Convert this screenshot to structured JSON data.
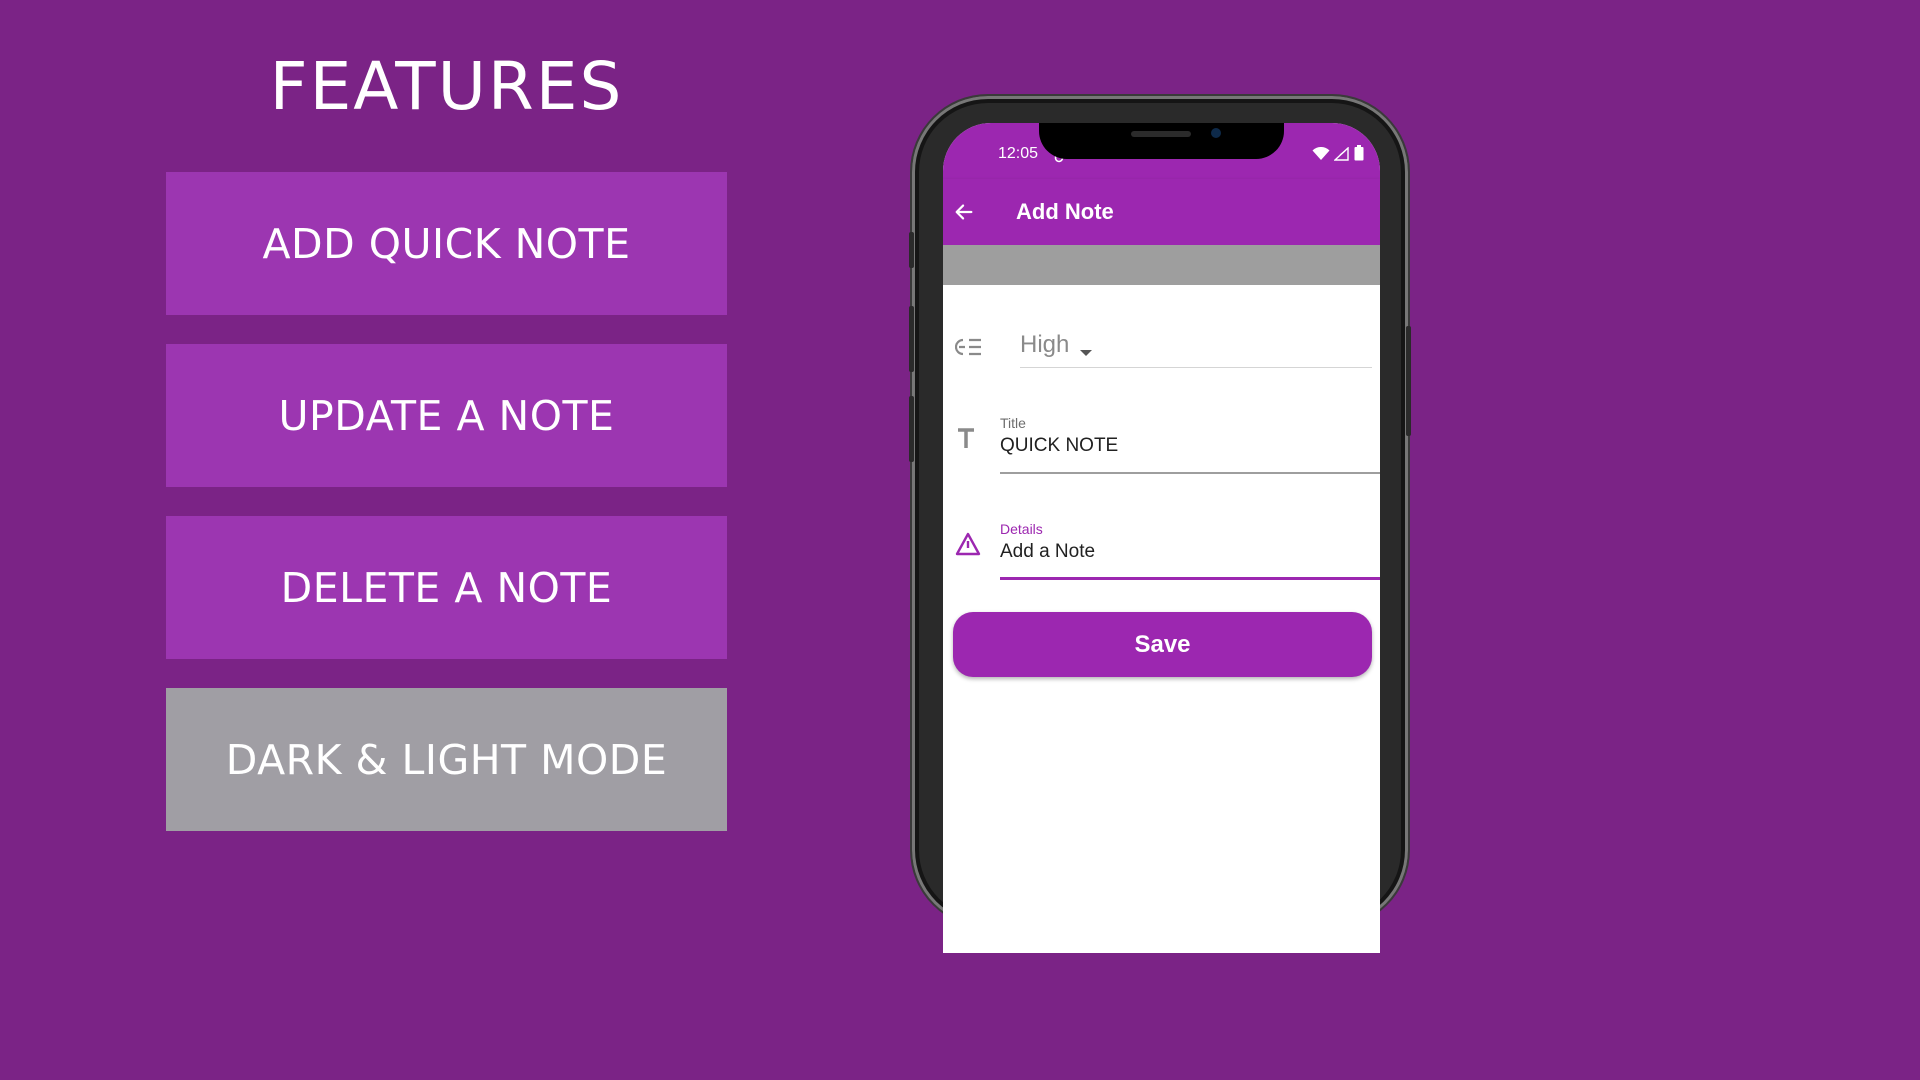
{
  "features": {
    "title": "FEATURES",
    "items": [
      {
        "label": "ADD QUICK NOTE"
      },
      {
        "label": "UPDATE A NOTE"
      },
      {
        "label": "DELETE A NOTE"
      },
      {
        "label": "DARK & LIGHT MODE"
      }
    ]
  },
  "phone": {
    "status_bar": {
      "time": "12:05"
    },
    "app_bar": {
      "title": "Add Note"
    },
    "form": {
      "priority": {
        "value": "High"
      },
      "title_field": {
        "label": "Title",
        "value": "QUICK NOTE"
      },
      "details_field": {
        "label": "Details",
        "value": "Add a Note"
      },
      "save_label": "Save"
    }
  },
  "colors": {
    "background": "#7b2386",
    "feature_box": "#9c36b1",
    "feature_box_gray": "#a09ea4",
    "accent": "#9c27b0"
  },
  "icons": [
    "back-arrow-icon",
    "priority-icon",
    "title-text-icon",
    "warning-icon",
    "dropdown-arrow-icon",
    "wifi-icon",
    "signal-icon",
    "battery-icon",
    "sync-icon"
  ]
}
